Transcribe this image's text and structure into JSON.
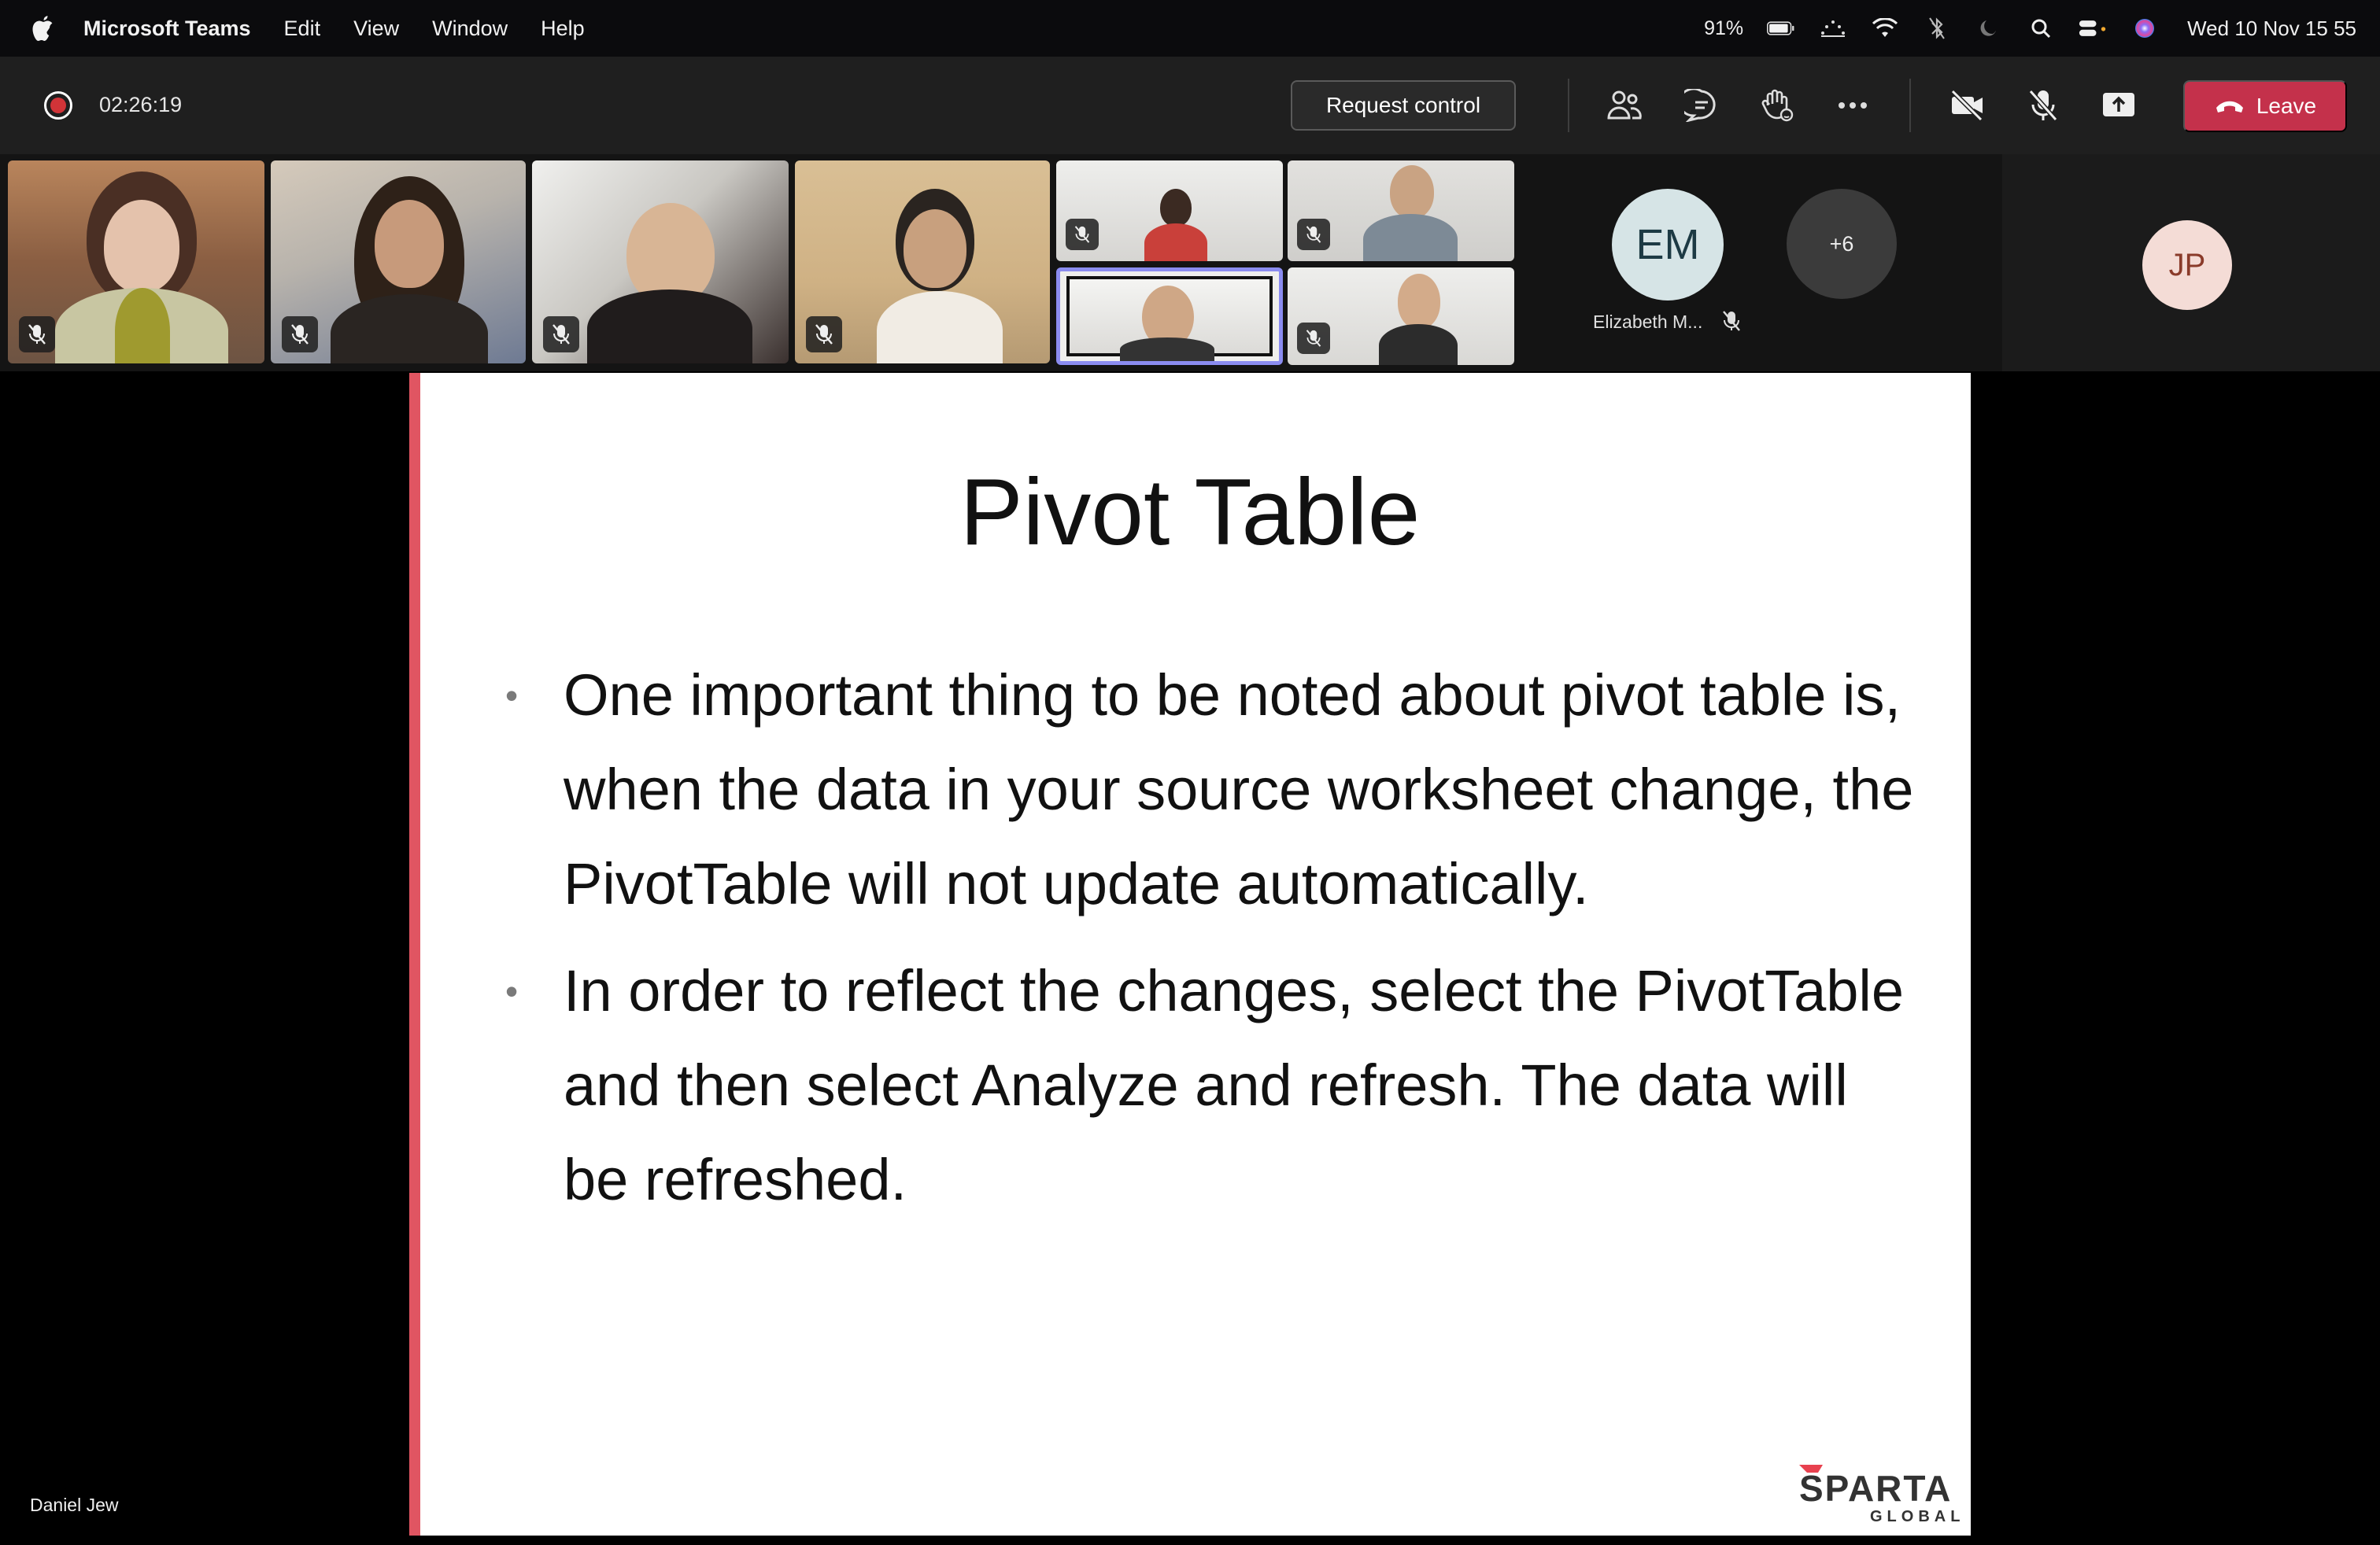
{
  "menubar": {
    "app_name": "Microsoft Teams",
    "menus": [
      "Edit",
      "View",
      "Window",
      "Help"
    ],
    "battery": "91%",
    "datetime": "Wed 10 Nov  15 55"
  },
  "meeting": {
    "timer": "02:26:19",
    "request_control_label": "Request control",
    "leave_label": "Leave",
    "accent_color": "#c4314b"
  },
  "participants": {
    "em_initials": "EM",
    "em_name": "Elizabeth M...",
    "overflow_count": "+6",
    "jp_initials": "JP"
  },
  "slide": {
    "title": "Pivot Table",
    "bullets": [
      "One important thing to be noted about pivot table is, when the data in your source worksheet change, the PivotTable will not update automatically.",
      "In order to reflect the changes, select the PivotTable and then select Analyze and refresh. The data will be refreshed."
    ],
    "logo_text": "SPARTA",
    "logo_subtext": "GLOBAL"
  },
  "presenter": {
    "name": "Daniel Jew"
  }
}
